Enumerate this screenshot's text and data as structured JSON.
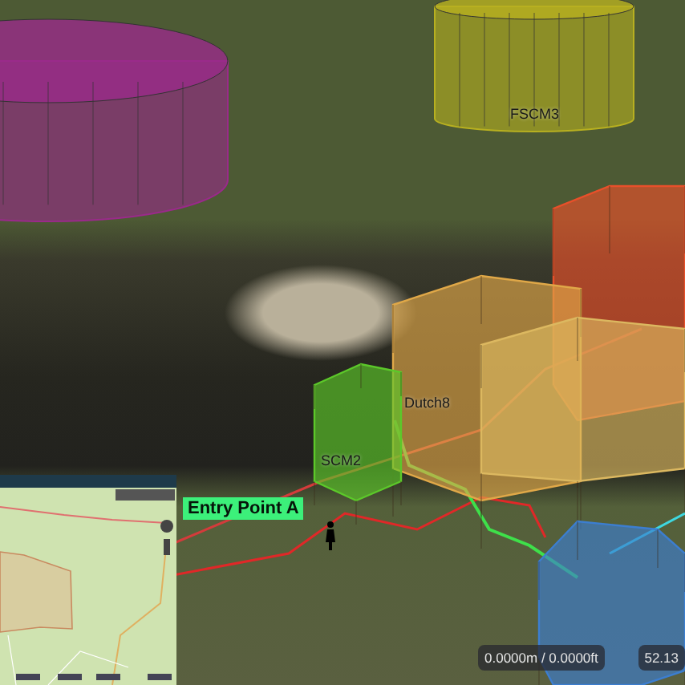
{
  "volumes": [
    {
      "kind": "cylinder",
      "color": "#9a2a8a"
    },
    {
      "kind": "cylinder",
      "color": "#b8b020"
    },
    {
      "kind": "prism",
      "color": "#e8502a"
    },
    {
      "kind": "prism",
      "color": "#e0a848"
    },
    {
      "kind": "prism",
      "color": "#dcb860"
    },
    {
      "kind": "prism",
      "color": "#5cc82a"
    },
    {
      "kind": "prism",
      "color": "#3c7ed0"
    }
  ],
  "labels": [
    {
      "text": "FSCM3"
    },
    {
      "text": "SCM2"
    },
    {
      "text": "Dutch8"
    }
  ],
  "callout": {
    "text": "Entry Point A"
  },
  "readouts": [
    "0.0000m / 0.0000ft",
    "52.13"
  ]
}
